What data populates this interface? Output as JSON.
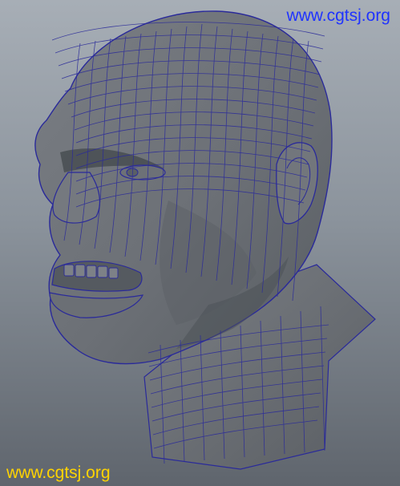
{
  "viewport": {
    "background_top": "#a7aeb6",
    "background_bottom": "#5f656d",
    "mesh_fill": "#6f7378",
    "mesh_shade": "#4f5459",
    "wire_color": "#2a2a9a"
  },
  "watermarks": {
    "top_right": "www.cgtsj.org",
    "bottom_left": "www.cgtsj.org",
    "top_color": "#1f33ff",
    "bottom_color": "#ffd400"
  }
}
